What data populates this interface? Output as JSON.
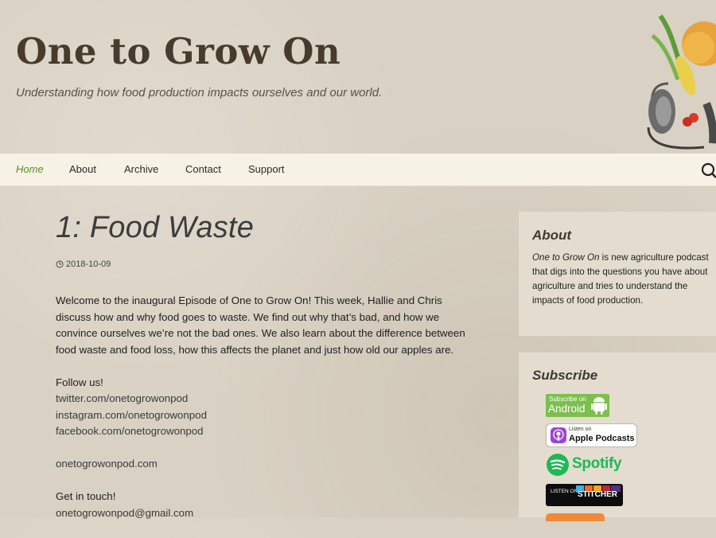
{
  "site": {
    "title": "One to Grow On",
    "tagline": "Understanding how food production impacts ourselves and our world."
  },
  "nav": {
    "items": [
      {
        "label": "Home",
        "active": true
      },
      {
        "label": "About",
        "active": false
      },
      {
        "label": "Archive",
        "active": false
      },
      {
        "label": "Contact",
        "active": false
      },
      {
        "label": "Support",
        "active": false
      }
    ],
    "search_icon": "search-icon"
  },
  "post": {
    "title": "1: Food Waste",
    "date": "2018-10-09",
    "intro": "Welcome to the inaugural Episode of One to Grow On! This week, Hallie and Chris discuss how and why food goes to waste. We find out why that’s bad, and how we convince ourselves we’re not the bad ones. We also learn about the difference between food waste and food loss,  how this affects the planet and just how old our apples are.",
    "follow_label": "Follow us!",
    "links": [
      "twitter.com/onetogrowonpod",
      "instagram.com/onetogrowonpod",
      "facebook.com/onetogrowonpod"
    ],
    "website": "onetogrowonpod.com",
    "contact_label": "Get in touch!",
    "email": "onetogrowonpod@gmail.com"
  },
  "sidebar": {
    "about": {
      "title": "About",
      "show_name": "One to Grow On",
      "text": " is new agriculture podcast that digs into the questions you have about agriculture and tries to understand the impacts of food production."
    },
    "subscribe": {
      "title": "Subscribe",
      "badges": [
        {
          "small": "Subscribe on",
          "big": "Android"
        },
        {
          "small": "Listen on",
          "big": "Apple Podcasts"
        },
        {
          "big": "Spotify"
        },
        {
          "small": "LISTEN ON",
          "big": "STITCHER"
        }
      ]
    }
  },
  "colors": {
    "background": "#d9d1c3",
    "nav_background": "#f6f3e6",
    "nav_active": "#5b8b2c",
    "title": "#473b2b",
    "android_green": "#7cbf4d",
    "spotify_green": "#1db954"
  }
}
